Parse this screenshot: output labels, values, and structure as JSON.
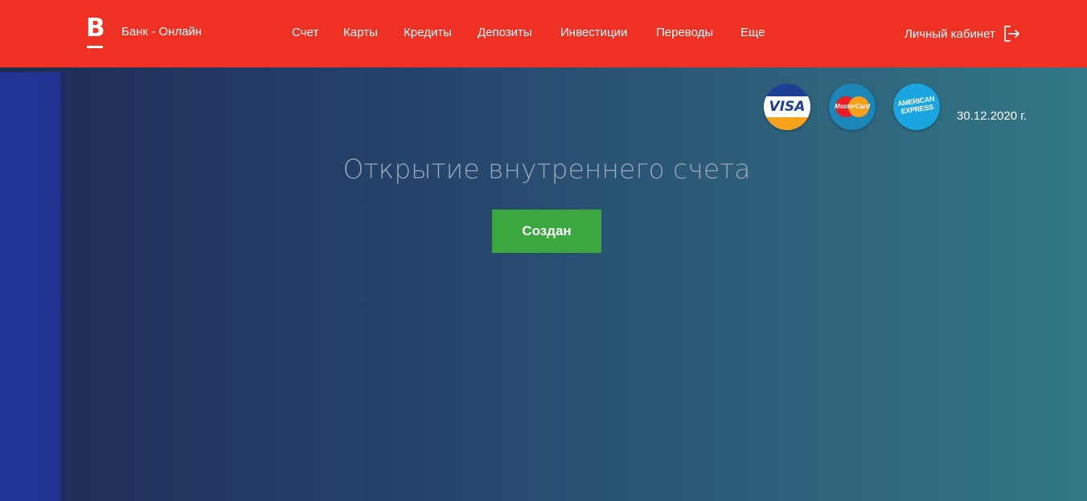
{
  "header": {
    "logo_letter": "B",
    "brand": "Банк - Онлайн",
    "nav": [
      {
        "label": "Счет"
      },
      {
        "label": "Карты"
      },
      {
        "label": "Кредиты"
      },
      {
        "label": "Депозиты"
      },
      {
        "label": "Инвестиции"
      },
      {
        "label": "Переводы"
      },
      {
        "label": "Еще"
      }
    ],
    "cabinet_label": "Личный кабинет",
    "cabinet_icon": "logout-icon"
  },
  "cards": {
    "visa": "VISA",
    "mastercard": "MasterCard",
    "amex_line1": "AMERICAN",
    "amex_line2": "EXPRESS"
  },
  "date": "30.12.2020 г.",
  "main": {
    "title": "Открытие внутреннего счета",
    "status_button": "Создан"
  },
  "colors": {
    "header_bg": "#ef3124",
    "button_bg": "#3aa83e",
    "title_color": "#98a6b8"
  }
}
